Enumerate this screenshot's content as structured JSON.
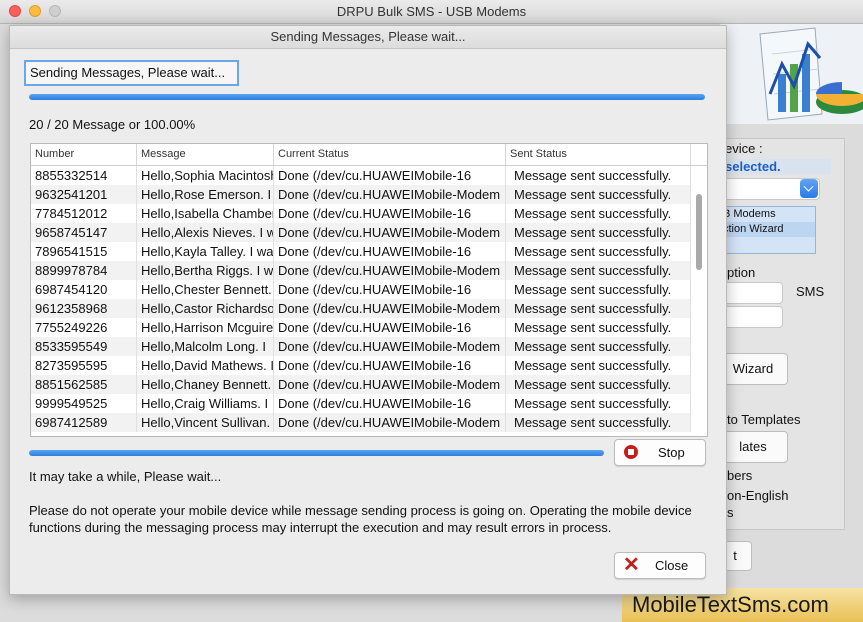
{
  "window": {
    "title": "DRPU Bulk SMS - USB Modems"
  },
  "background": {
    "device_label": "evice :",
    "selected_link": "selected.",
    "modem_line1": "B Modems",
    "modem_line2": "ction  Wizard",
    "option_label": "ption",
    "sms_label": "SMS",
    "wizard_button": "Wizard",
    "templates_label": "to Templates",
    "templates_button": "lates",
    "numbers_label": "bers",
    "non_english_label": "on-English",
    "s_label": "s",
    "t_button": "t",
    "watermark": "MobileTextSms.com"
  },
  "dialog": {
    "title": "Sending Messages, Please wait...",
    "header_status": "Sending Messages, Please wait...",
    "top_progress": 1.0,
    "count_text": "20 / 20 Message or 100.00%",
    "columns": [
      "Number",
      "Message",
      "Current Status",
      "Sent Status"
    ],
    "rows": [
      [
        "8855332514",
        "Hello,Sophia Macintosh.",
        "Done (/dev/cu.HUAWEIMobile-16",
        "Message sent successfully."
      ],
      [
        "9632541201",
        "Hello,Rose Emerson. I",
        "Done (/dev/cu.HUAWEIMobile-Modem",
        "Message sent successfully."
      ],
      [
        "7784512012",
        "Hello,Isabella Chamberlain.",
        "Done (/dev/cu.HUAWEIMobile-16",
        "Message sent successfully."
      ],
      [
        "9658745147",
        "Hello,Alexis Nieves. I w",
        "Done (/dev/cu.HUAWEIMobile-Modem",
        "Message sent successfully."
      ],
      [
        "7896541515",
        "Hello,Kayla Talley. I wa",
        "Done (/dev/cu.HUAWEIMobile-16",
        "Message sent successfully."
      ],
      [
        "8899978784",
        "Hello,Bertha Riggs. I w",
        "Done (/dev/cu.HUAWEIMobile-Modem",
        "Message sent successfully."
      ],
      [
        "6987454120",
        "Hello,Chester Bennett.",
        "Done (/dev/cu.HUAWEIMobile-16",
        "Message sent successfully."
      ],
      [
        "9612358968",
        "Hello,Castor Richardson.",
        "Done (/dev/cu.HUAWEIMobile-Modem",
        "Message sent successfully."
      ],
      [
        "7755249226",
        "Hello,Harrison Mcguire.",
        "Done (/dev/cu.HUAWEIMobile-16",
        "Message sent successfully."
      ],
      [
        "8533595549",
        "Hello,Malcolm Long. I",
        "Done (/dev/cu.HUAWEIMobile-Modem",
        "Message sent successfully."
      ],
      [
        "8273595595",
        "Hello,David Mathews. I",
        "Done (/dev/cu.HUAWEIMobile-16",
        "Message sent successfully."
      ],
      [
        "8851562585",
        "Hello,Chaney Bennett.",
        "Done (/dev/cu.HUAWEIMobile-Modem",
        "Message sent successfully."
      ],
      [
        "9999549525",
        "Hello,Craig Williams. I",
        "Done (/dev/cu.HUAWEIMobile-16",
        "Message sent successfully."
      ],
      [
        "6987412589",
        "Hello,Vincent Sullivan.",
        "Done (/dev/cu.HUAWEIMobile-Modem",
        "Message sent successfully."
      ]
    ],
    "bottom_progress": 1.0,
    "stop_label": "Stop",
    "wait_text": "It may take a while, Please wait...",
    "notice": "Please do not operate your mobile device while message sending process is going on. Operating the mobile device functions during the messaging process may interrupt the execution and may result errors in process.",
    "close_label": "Close"
  }
}
